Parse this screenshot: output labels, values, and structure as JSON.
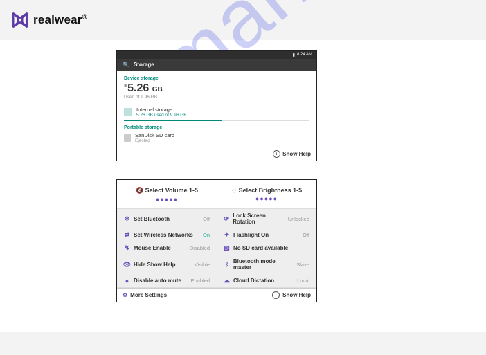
{
  "brand": {
    "name": "realwear",
    "registered": "®"
  },
  "watermark": "manualshive.com",
  "storage_panel": {
    "time": "8:24 AM",
    "title": "Storage",
    "device_section": "Device storage",
    "used_value": "5.26",
    "used_unit": "GB",
    "used_caption": "Used of 9.96 GB",
    "internal": {
      "name": "Internal storage",
      "detail": "5.26 GB used of 9.96 GB",
      "progress_pct": 53
    },
    "portable_section": "Portable storage",
    "sd": {
      "name": "SanDisk SD card",
      "detail": "Ejected"
    },
    "help": "Show Help"
  },
  "quick_panel": {
    "volume_label": "Select Volume 1-5",
    "brightness_label": "Select Brightness 1-5",
    "dots": "●●●●●",
    "rows": [
      {
        "l_icon": "✻",
        "l_text": "Set Bluetooth",
        "l_val": "Off",
        "r_icon": "⟳",
        "r_text": "Lock Screen Rotation",
        "r_val": "Unlocked"
      },
      {
        "l_icon": "⇄",
        "l_text": "Set Wireless Networks",
        "l_val": "On",
        "r_icon": "✦",
        "r_text": "Flashlight On",
        "r_val": "Off"
      },
      {
        "l_icon": "↯",
        "l_text": "Mouse Enable",
        "l_val": "Disabled",
        "r_icon": "▧",
        "r_text": "No SD card available",
        "r_val": ""
      },
      {
        "l_icon": "👁",
        "l_text": "Hide Show Help",
        "l_val": "Visible",
        "r_icon": "ᛒ",
        "r_text": "Bluetooth mode master",
        "r_val": "Slave"
      },
      {
        "l_icon": "●",
        "l_text": "Disable auto mute",
        "l_val": "Enabled",
        "r_icon": "☁",
        "r_text": "Cloud Dictation",
        "r_val": "Local"
      }
    ],
    "more": "More Settings",
    "help": "Show Help"
  }
}
